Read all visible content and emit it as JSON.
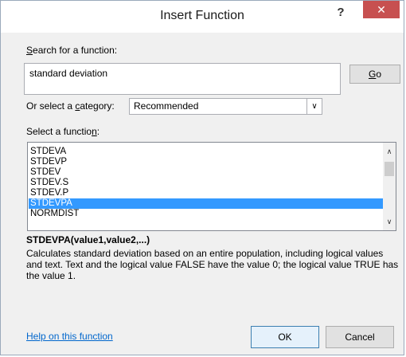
{
  "window": {
    "title": "Insert Function",
    "help_glyph": "?",
    "close_glyph": "✕"
  },
  "search": {
    "label_prefix": "",
    "label_access": "S",
    "label_rest": "earch for a function:",
    "value": "standard deviation",
    "go_access": "G",
    "go_rest": "o"
  },
  "category": {
    "label_before": "Or select a ",
    "label_access": "c",
    "label_after": "ategory:",
    "selected": "Recommended"
  },
  "function_list": {
    "label_before": "Select a functio",
    "label_access": "n",
    "label_after": ":",
    "items": [
      "STDEVA",
      "STDEVP",
      "STDEV",
      "STDEV.S",
      "STDEV.P",
      "STDEVPA",
      "NORMDIST"
    ],
    "selected_index": 5
  },
  "details": {
    "signature": "STDEVPA(value1,value2,...)",
    "description": "Calculates standard deviation based on an entire population, including logical values and text. Text and the logical value FALSE have the value 0; the logical value TRUE has the value 1."
  },
  "footer": {
    "help_link": "Help on this function",
    "ok_label": "OK",
    "cancel_label": "Cancel"
  },
  "colors": {
    "selection": "#3399ff",
    "close": "#c75050",
    "link": "#0066cc"
  }
}
